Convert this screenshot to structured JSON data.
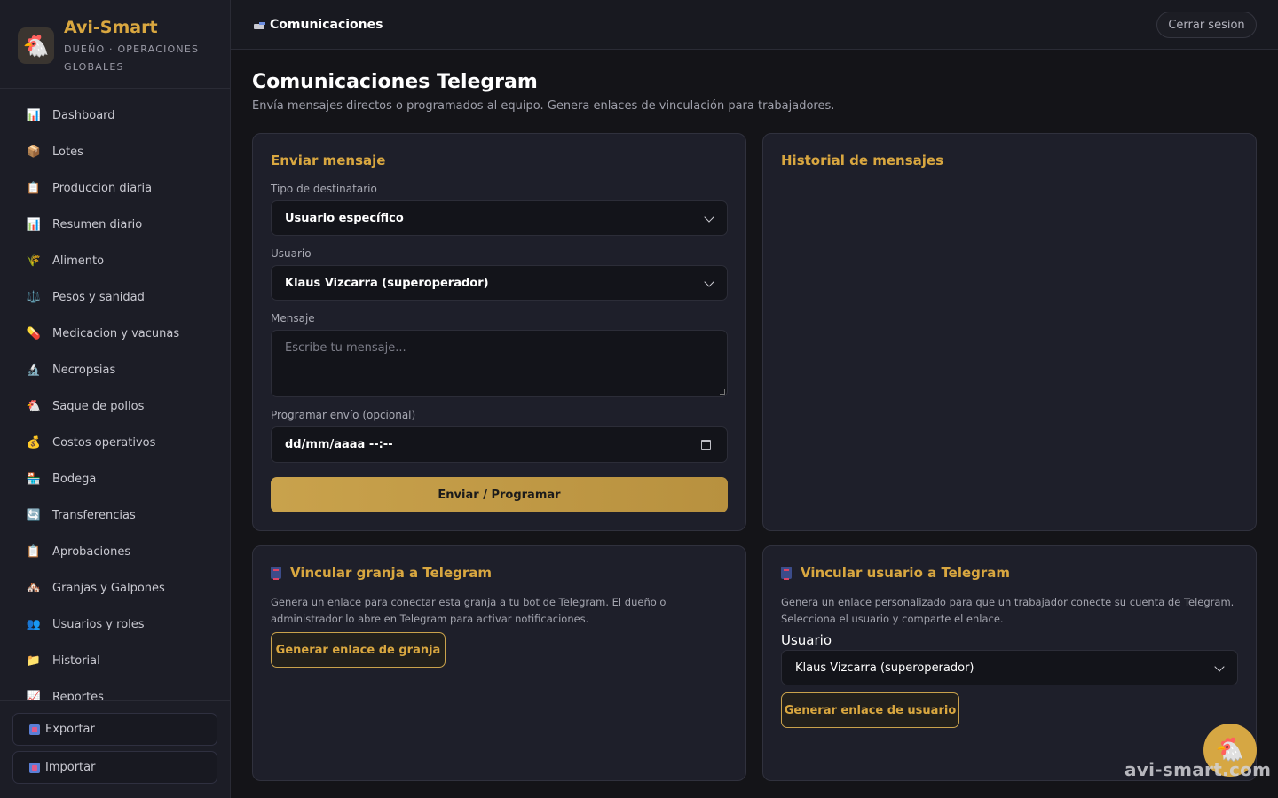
{
  "brand": {
    "title": "Avi-Smart",
    "subtitle": "DUEÑO · OPERACIONES GLOBALES",
    "logo_icon": "🐔"
  },
  "sidebar": {
    "items": [
      {
        "label": "Dashboard",
        "icon": "📊"
      },
      {
        "label": "Lotes",
        "icon": "📦"
      },
      {
        "label": "Produccion diaria",
        "icon": "📋"
      },
      {
        "label": "Resumen diario",
        "icon": "📊"
      },
      {
        "label": "Alimento",
        "icon": "🌾"
      },
      {
        "label": "Pesos y sanidad",
        "icon": "⚖️"
      },
      {
        "label": "Medicacion y vacunas",
        "icon": "💊"
      },
      {
        "label": "Necropsias",
        "icon": "🔬"
      },
      {
        "label": "Saque de pollos",
        "icon": "🐔"
      },
      {
        "label": "Costos operativos",
        "icon": "💰"
      },
      {
        "label": "Bodega",
        "icon": "🏪"
      },
      {
        "label": "Transferencias",
        "icon": "🔄"
      },
      {
        "label": "Aprobaciones",
        "icon": "📋"
      },
      {
        "label": "Granjas y Galpones",
        "icon": "🏘️"
      },
      {
        "label": "Usuarios y roles",
        "icon": "👥"
      },
      {
        "label": "Historial",
        "icon": "📁"
      },
      {
        "label": "Reportes",
        "icon": "📈"
      }
    ],
    "export_label": "Exportar",
    "import_label": "Importar"
  },
  "topbar": {
    "title": "Comunicaciones",
    "logout_label": "Cerrar sesion"
  },
  "main": {
    "title": "Comunicaciones Telegram",
    "subtitle": "Envía mensajes directos o programados al equipo. Genera enlaces de vinculación para trabajadores."
  },
  "send_card": {
    "title": "Enviar mensaje",
    "recipient_type_label": "Tipo de destinatario",
    "recipient_type_value": "Usuario específico",
    "user_label": "Usuario",
    "user_value": "Klaus Vizcarra (superoperador)",
    "message_label": "Mensaje",
    "message_placeholder": "Escribe tu mensaje...",
    "schedule_label": "Programar envío (opcional)",
    "schedule_value": "dd/mm/aaaa --:--",
    "submit_label": "Enviar / Programar"
  },
  "history_card": {
    "title": "Historial de mensajes"
  },
  "farm_link_card": {
    "title": "Vincular granja a Telegram",
    "description": "Genera un enlace para conectar esta granja a tu bot de Telegram. El dueño o administrador lo abre en Telegram para activar notificaciones.",
    "button_label": "Generar enlace de granja"
  },
  "user_link_card": {
    "title": "Vincular usuario a Telegram",
    "description": "Genera un enlace personalizado para que un trabajador conecte su cuenta de Telegram. Selecciona el usuario y comparte el enlace.",
    "user_label": "Usuario",
    "user_value": "Klaus Vizcarra (superoperador)",
    "button_label": "Generar enlace de usuario"
  },
  "fab_icon": "🐔",
  "watermark": "avi-smart.com",
  "colors": {
    "accent": "#d9a740",
    "background": "#141418",
    "card": "#1e1f2a"
  }
}
